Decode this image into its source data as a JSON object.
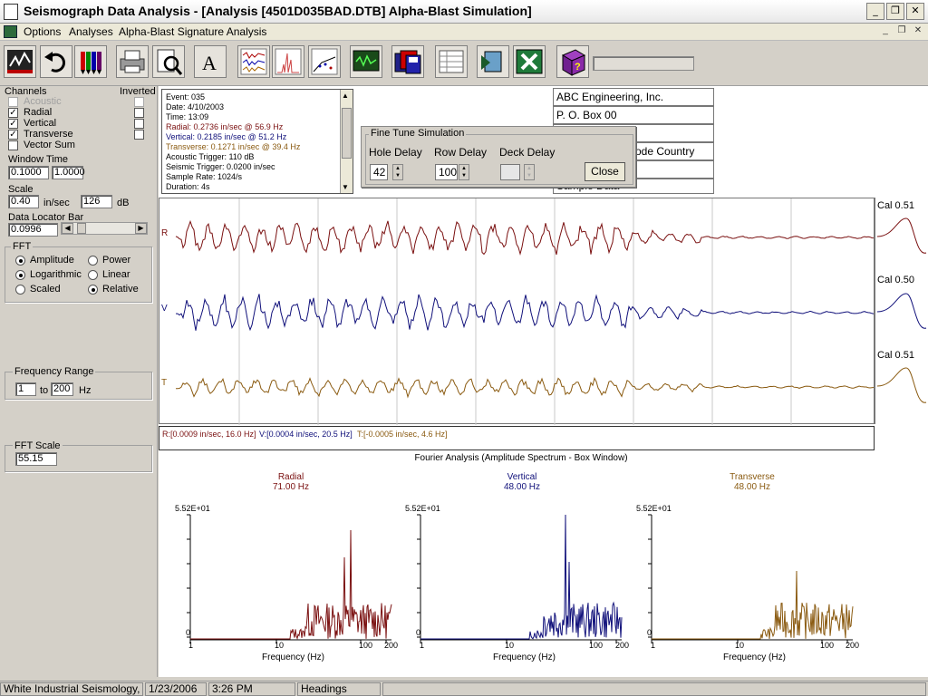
{
  "window": {
    "title": "Seismograph Data Analysis - [Analysis [4501D035BAD.DTB] Alpha-Blast Simulation]",
    "minimize": "_",
    "restore": "❐",
    "close": "✕"
  },
  "menu": {
    "items": [
      "Options",
      "Analyses",
      "Alpha-Blast Signature Analysis"
    ]
  },
  "toolbar": {
    "icons": [
      "seismograph-icon",
      "undo-icon",
      "pencils-icon",
      "print-icon",
      "print-preview-icon",
      "text-icon",
      "waveform-chart-icon",
      "spectrum-chart-icon",
      "compliance-chart-icon",
      "monitor-icon",
      "save-disks-icon",
      "table-icon",
      "export-icon",
      "excel-icon",
      "help-book-icon"
    ],
    "text_icon_glyph": "A"
  },
  "channels": {
    "label": "Channels",
    "inverted_label": "Inverted",
    "items": [
      {
        "name": "Acoustic",
        "checked": false,
        "disabled": true
      },
      {
        "name": "Radial",
        "checked": true,
        "disabled": false
      },
      {
        "name": "Vertical",
        "checked": true,
        "disabled": false
      },
      {
        "name": "Transverse",
        "checked": true,
        "disabled": false
      },
      {
        "name": "Vector Sum",
        "checked": false,
        "disabled": false
      }
    ]
  },
  "window_time": {
    "label": "Window Time",
    "start": "0.1000",
    "end": "1.0000"
  },
  "scale": {
    "label": "Scale",
    "value": "0.40",
    "unit": "in/sec",
    "db_value": "126",
    "db_unit": "dB"
  },
  "locator": {
    "label": "Data Locator Bar",
    "value": "0.0996"
  },
  "fft": {
    "label": "FFT",
    "options": [
      {
        "label": "Amplitude",
        "selected": true
      },
      {
        "label": "Power",
        "selected": false
      },
      {
        "label": "Logarithmic",
        "selected": true
      },
      {
        "label": "Linear",
        "selected": false
      },
      {
        "label": "Scaled",
        "selected": false
      },
      {
        "label": "Relative",
        "selected": true
      }
    ]
  },
  "frequency_range": {
    "label": "Frequency Range",
    "from": "1",
    "to_label": "to",
    "to": "200",
    "unit": "Hz"
  },
  "fft_scale": {
    "label": "FFT Scale",
    "value": "55.15"
  },
  "event_info": {
    "lines": [
      {
        "text": "Event: 035",
        "color": "#000000"
      },
      {
        "text": "Date: 4/10/2003",
        "color": "#000000"
      },
      {
        "text": "Time: 13:09",
        "color": "#000000"
      },
      {
        "text": "Radial: 0.2736 in/sec @ 56.9 Hz",
        "color": "#7a1010"
      },
      {
        "text": "Vertical: 0.2185 in/sec @ 51.2 Hz",
        "color": "#10107a"
      },
      {
        "text": "Transverse: 0.1271 in/sec @ 39.4 Hz",
        "color": "#8a5a10"
      },
      {
        "text": "Acoustic Trigger: 110 dB",
        "color": "#000000"
      },
      {
        "text": "Seismic Trigger: 0.0200 in/sec",
        "color": "#000000"
      },
      {
        "text": "Sample Rate: 1024/s",
        "color": "#000000"
      },
      {
        "text": "Duration: 4s",
        "color": "#000000"
      }
    ]
  },
  "address": {
    "company": "ABC Engineering, Inc.",
    "line2": "P. O. Box 00",
    "line4_visible": "ode Country",
    "line6_visible": "Sample Data"
  },
  "fine_tune": {
    "title": "Fine Tune Simulation",
    "hole_delay_label": "Hole Delay",
    "hole_delay": "42",
    "row_delay_label": "Row Delay",
    "row_delay": "100",
    "deck_delay_label": "Deck Delay",
    "deck_delay": "",
    "close_label": "Close"
  },
  "traces": [
    {
      "label": "R",
      "cal": "Cal 0.51",
      "color": "#7a1010"
    },
    {
      "label": "V",
      "cal": "Cal 0.50",
      "color": "#10107a"
    },
    {
      "label": "T",
      "cal": "Cal 0.51",
      "color": "#8a5a10"
    }
  ],
  "readout": {
    "r": "R:[0.0009 in/sec, 16.0 Hz]",
    "v": "V:[0.0004 in/sec, 20.5 Hz]",
    "t": "T:[-0.0005 in/sec, 4.6 Hz]"
  },
  "fourier": {
    "title": "Fourier Analysis (Amplitude Spectrum - Box Window)",
    "panels": [
      {
        "name": "Radial",
        "freq": "71.00 Hz",
        "color": "#7a1010",
        "ymax": "5.52E+01",
        "zero": "0",
        "xlabel": "Frequency (Hz)",
        "ticks": [
          "1",
          "10",
          "100",
          "200"
        ]
      },
      {
        "name": "Vertical",
        "freq": "48.00 Hz",
        "color": "#10107a",
        "ymax": "5.52E+01",
        "zero": "0",
        "xlabel": "Frequency (Hz)",
        "ticks": [
          "1",
          "10",
          "100",
          "200"
        ]
      },
      {
        "name": "Transverse",
        "freq": "48.00 Hz",
        "color": "#8a5a10",
        "ymax": "5.52E+01",
        "zero": "0",
        "xlabel": "Frequency (Hz)",
        "ticks": [
          "1",
          "10",
          "100",
          "200"
        ]
      }
    ]
  },
  "status": {
    "company": "White Industrial Seismology, Inc.",
    "date": "1/23/2006",
    "time": "3:26 PM",
    "mode": "Headings"
  }
}
